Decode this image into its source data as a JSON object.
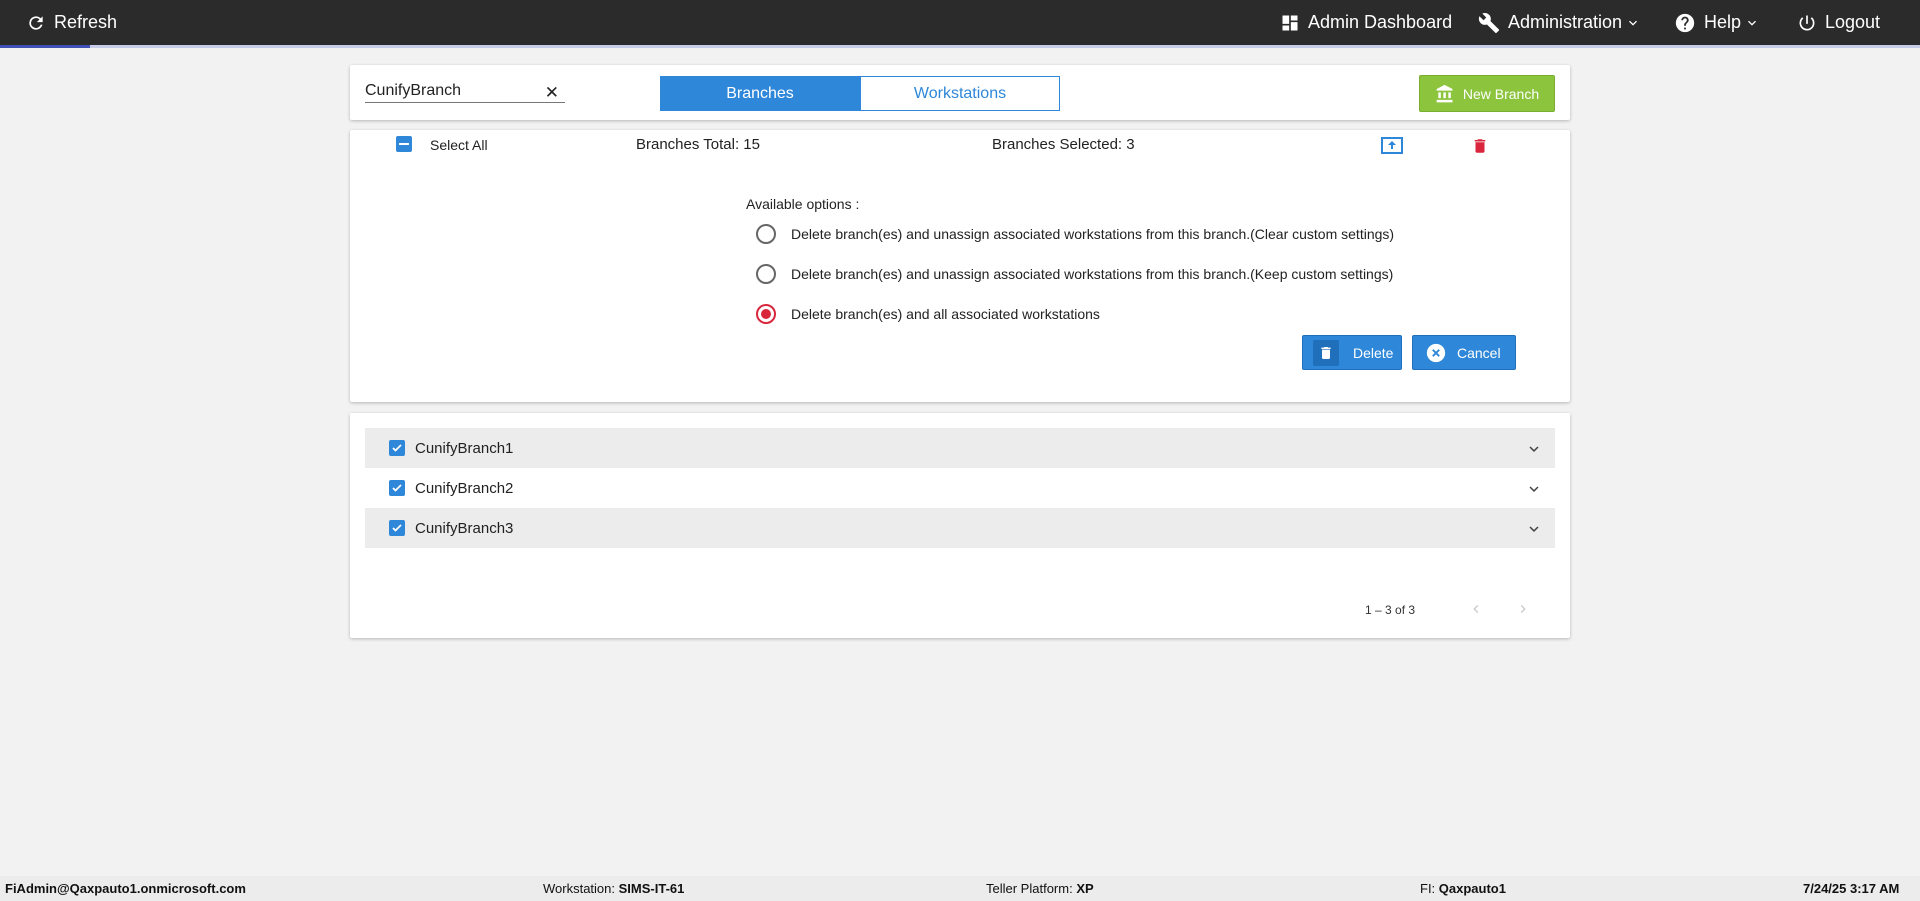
{
  "topbar": {
    "refresh_label": "Refresh",
    "admin_dashboard_label": "Admin Dashboard",
    "administration_label": "Administration",
    "help_label": "Help",
    "logout_label": "Logout",
    "load_progress": 0.047
  },
  "search": {
    "value": "CunifyBranch",
    "clear_icon": "close-icon"
  },
  "tabs": [
    {
      "label": "Branches",
      "active": true
    },
    {
      "label": "Workstations",
      "active": false
    }
  ],
  "new_branch_label": "New Branch",
  "summary": {
    "select_all_label": "Select All",
    "branches_total": "Branches Total: 15",
    "branches_selected": "Branches Selected: 3"
  },
  "options": {
    "heading": "Available options :",
    "choices": [
      {
        "label": "Delete branch(es) and unassign associated workstations from this branch.(Clear custom settings)",
        "selected": false
      },
      {
        "label": "Delete branch(es) and unassign associated workstations from this branch.(Keep custom settings)",
        "selected": false
      },
      {
        "label": "Delete branch(es) and all associated workstations",
        "selected": true
      }
    ],
    "delete_label": "Delete",
    "cancel_label": "Cancel"
  },
  "branches": [
    {
      "name": "CunifyBranch1",
      "checked": true
    },
    {
      "name": "CunifyBranch2",
      "checked": true
    },
    {
      "name": "CunifyBranch3",
      "checked": true
    }
  ],
  "pager": {
    "range": "1 – 3 of 3"
  },
  "footer": {
    "user": "FiAdmin@Qaxpauto1.onmicrosoft.com",
    "workstation_label": "Workstation:",
    "workstation_value": "SIMS-IT-61",
    "platform_label": "Teller Platform:",
    "platform_value": "XP",
    "fi_label": "FI:",
    "fi_value": "Qaxpauto1",
    "datetime": "7/24/25 3:17 AM"
  },
  "colors": {
    "accent_blue": "#2e87d8",
    "new_branch_green": "#8cc43d",
    "delete_red": "#d9263c",
    "topbar_bg": "#2b2b2b"
  }
}
